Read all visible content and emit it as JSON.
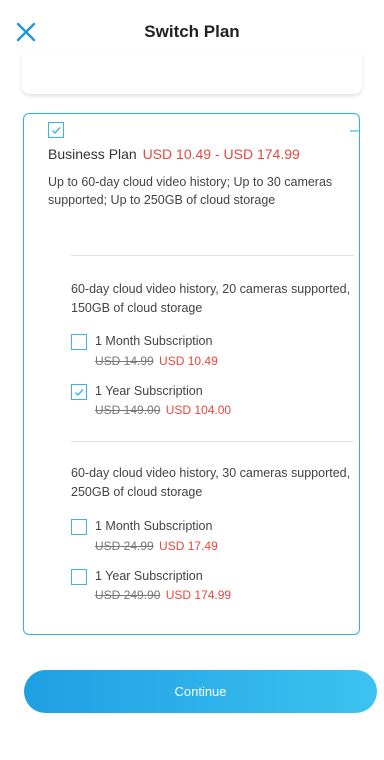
{
  "header": {
    "title": "Switch Plan",
    "close_icon": "close-icon"
  },
  "plan": {
    "name": "Business Plan",
    "price_range": "USD 10.49 - USD 174.99",
    "description": "Up to 60-day cloud video history; Up to 30 cameras supported; Up to 250GB of cloud storage",
    "expanded": true,
    "checked": true
  },
  "tiers": [
    {
      "description": "60-day cloud video history, 20 cameras supported, 150GB of cloud storage",
      "options": [
        {
          "label": "1 Month Subscription",
          "old_price": "USD 14.99",
          "new_price": "USD 10.49",
          "checked": false
        },
        {
          "label": "1 Year Subscription",
          "old_price": "USD 149.00",
          "new_price": "USD 104.00",
          "checked": true
        }
      ]
    },
    {
      "description": "60-day cloud video history, 30 cameras supported, 250GB of cloud storage",
      "options": [
        {
          "label": "1 Month Subscription",
          "old_price": "USD 24.99",
          "new_price": "USD 17.49",
          "checked": false
        },
        {
          "label": "1 Year Subscription",
          "old_price": "USD 249.90",
          "new_price": "USD 174.99",
          "checked": false
        }
      ]
    }
  ],
  "continue_label": "Continue",
  "colors": {
    "accent": "#2bb3e6",
    "price": "#e8473a",
    "button_start": "#1f9fe3",
    "button_end": "#3cc3f0"
  }
}
